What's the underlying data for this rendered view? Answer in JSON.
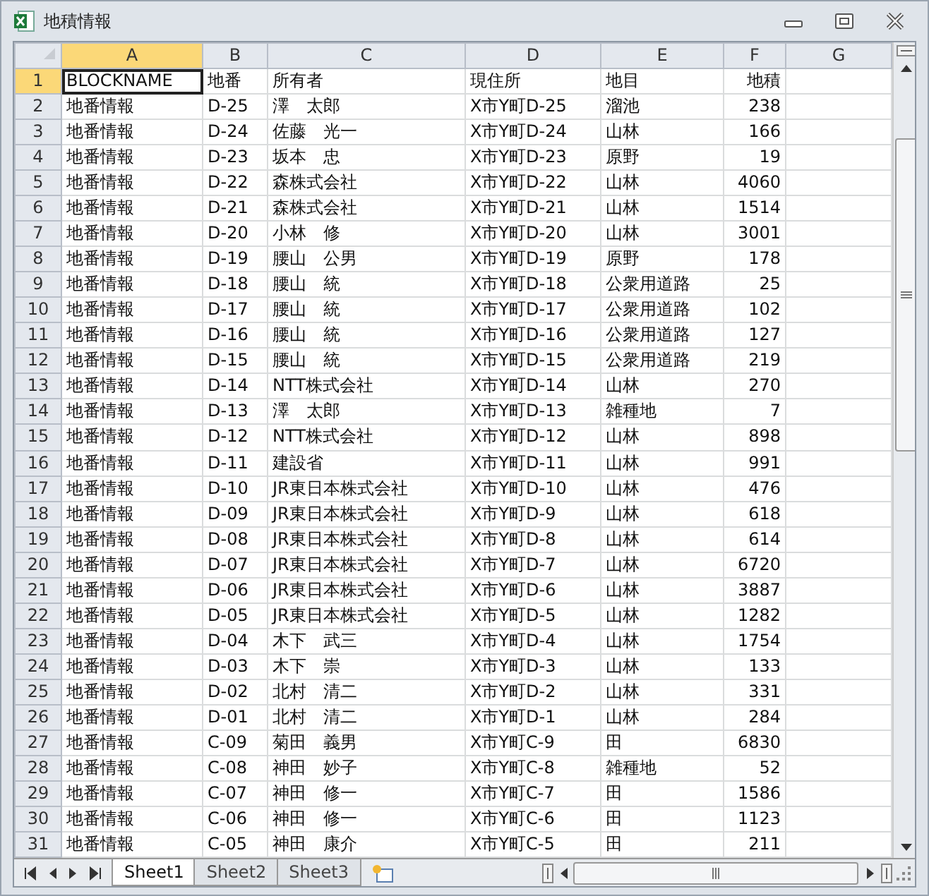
{
  "window": {
    "title": "地積情報"
  },
  "columns": [
    {
      "letter": "A",
      "selected": true,
      "kind": "text"
    },
    {
      "letter": "B",
      "selected": false,
      "kind": "text"
    },
    {
      "letter": "C",
      "selected": false,
      "kind": "text"
    },
    {
      "letter": "D",
      "selected": false,
      "kind": "text"
    },
    {
      "letter": "E",
      "selected": false,
      "kind": "text"
    },
    {
      "letter": "F",
      "selected": false,
      "kind": "number"
    },
    {
      "letter": "G",
      "selected": false,
      "kind": "text"
    }
  ],
  "rows": [
    {
      "number": "1",
      "selected": true,
      "cells": [
        "BLOCKNAME",
        "地番",
        "所有者",
        "現住所",
        "地目",
        "地積"
      ]
    },
    {
      "number": "2",
      "selected": false,
      "cells": [
        "地番情報",
        "D-25",
        "澤　太郎",
        "X市Y町D-25",
        "溜池",
        "238"
      ]
    },
    {
      "number": "3",
      "selected": false,
      "cells": [
        "地番情報",
        "D-24",
        "佐藤　光一",
        "X市Y町D-24",
        "山林",
        "166"
      ]
    },
    {
      "number": "4",
      "selected": false,
      "cells": [
        "地番情報",
        "D-23",
        "坂本　忠",
        "X市Y町D-23",
        "原野",
        "19"
      ]
    },
    {
      "number": "5",
      "selected": false,
      "cells": [
        "地番情報",
        "D-22",
        "森株式会社",
        "X市Y町D-22",
        "山林",
        "4060"
      ]
    },
    {
      "number": "6",
      "selected": false,
      "cells": [
        "地番情報",
        "D-21",
        "森株式会社",
        "X市Y町D-21",
        "山林",
        "1514"
      ]
    },
    {
      "number": "7",
      "selected": false,
      "cells": [
        "地番情報",
        "D-20",
        "小林　修",
        "X市Y町D-20",
        "山林",
        "3001"
      ]
    },
    {
      "number": "8",
      "selected": false,
      "cells": [
        "地番情報",
        "D-19",
        "腰山　公男",
        "X市Y町D-19",
        "原野",
        "178"
      ]
    },
    {
      "number": "9",
      "selected": false,
      "cells": [
        "地番情報",
        "D-18",
        "腰山　統",
        "X市Y町D-18",
        "公衆用道路",
        "25"
      ]
    },
    {
      "number": "10",
      "selected": false,
      "cells": [
        "地番情報",
        "D-17",
        "腰山　統",
        "X市Y町D-17",
        "公衆用道路",
        "102"
      ]
    },
    {
      "number": "11",
      "selected": false,
      "cells": [
        "地番情報",
        "D-16",
        "腰山　統",
        "X市Y町D-16",
        "公衆用道路",
        "127"
      ]
    },
    {
      "number": "12",
      "selected": false,
      "cells": [
        "地番情報",
        "D-15",
        "腰山　統",
        "X市Y町D-15",
        "公衆用道路",
        "219"
      ]
    },
    {
      "number": "13",
      "selected": false,
      "cells": [
        "地番情報",
        "D-14",
        "NTT株式会社",
        "X市Y町D-14",
        "山林",
        "270"
      ]
    },
    {
      "number": "14",
      "selected": false,
      "cells": [
        "地番情報",
        "D-13",
        "澤　太郎",
        "X市Y町D-13",
        "雑種地",
        "7"
      ]
    },
    {
      "number": "15",
      "selected": false,
      "cells": [
        "地番情報",
        "D-12",
        "NTT株式会社",
        "X市Y町D-12",
        "山林",
        "898"
      ]
    },
    {
      "number": "16",
      "selected": false,
      "cells": [
        "地番情報",
        "D-11",
        "建設省",
        "X市Y町D-11",
        "山林",
        "991"
      ]
    },
    {
      "number": "17",
      "selected": false,
      "cells": [
        "地番情報",
        "D-10",
        "JR東日本株式会社",
        "X市Y町D-10",
        "山林",
        "476"
      ]
    },
    {
      "number": "18",
      "selected": false,
      "cells": [
        "地番情報",
        "D-09",
        "JR東日本株式会社",
        "X市Y町D-9",
        "山林",
        "618"
      ]
    },
    {
      "number": "19",
      "selected": false,
      "cells": [
        "地番情報",
        "D-08",
        "JR東日本株式会社",
        "X市Y町D-8",
        "山林",
        "614"
      ]
    },
    {
      "number": "20",
      "selected": false,
      "cells": [
        "地番情報",
        "D-07",
        "JR東日本株式会社",
        "X市Y町D-7",
        "山林",
        "6720"
      ]
    },
    {
      "number": "21",
      "selected": false,
      "cells": [
        "地番情報",
        "D-06",
        "JR東日本株式会社",
        "X市Y町D-6",
        "山林",
        "3887"
      ]
    },
    {
      "number": "22",
      "selected": false,
      "cells": [
        "地番情報",
        "D-05",
        "JR東日本株式会社",
        "X市Y町D-5",
        "山林",
        "1282"
      ]
    },
    {
      "number": "23",
      "selected": false,
      "cells": [
        "地番情報",
        "D-04",
        "木下　武三",
        "X市Y町D-4",
        "山林",
        "1754"
      ]
    },
    {
      "number": "24",
      "selected": false,
      "cells": [
        "地番情報",
        "D-03",
        "木下　崇",
        "X市Y町D-3",
        "山林",
        "133"
      ]
    },
    {
      "number": "25",
      "selected": false,
      "cells": [
        "地番情報",
        "D-02",
        "北村　清二",
        "X市Y町D-2",
        "山林",
        "331"
      ]
    },
    {
      "number": "26",
      "selected": false,
      "cells": [
        "地番情報",
        "D-01",
        "北村　清二",
        "X市Y町D-1",
        "山林",
        "284"
      ]
    },
    {
      "number": "27",
      "selected": false,
      "cells": [
        "地番情報",
        "C-09",
        "菊田　義男",
        "X市Y町C-9",
        "田",
        "6830"
      ]
    },
    {
      "number": "28",
      "selected": false,
      "cells": [
        "地番情報",
        "C-08",
        "神田　妙子",
        "X市Y町C-8",
        "雑種地",
        "52"
      ]
    },
    {
      "number": "29",
      "selected": false,
      "cells": [
        "地番情報",
        "C-07",
        "神田　修一",
        "X市Y町C-7",
        "田",
        "1586"
      ]
    },
    {
      "number": "30",
      "selected": false,
      "cells": [
        "地番情報",
        "C-06",
        "神田　修一",
        "X市Y町C-6",
        "田",
        "1123"
      ]
    },
    {
      "number": "31",
      "selected": false,
      "cells": [
        "地番情報",
        "C-05",
        "神田　康介",
        "X市Y町C-5",
        "田",
        "211"
      ]
    }
  ],
  "sheet_tabs": [
    {
      "label": "Sheet1",
      "selected": true
    },
    {
      "label": "Sheet2",
      "selected": false
    },
    {
      "label": "Sheet3",
      "selected": false
    }
  ]
}
